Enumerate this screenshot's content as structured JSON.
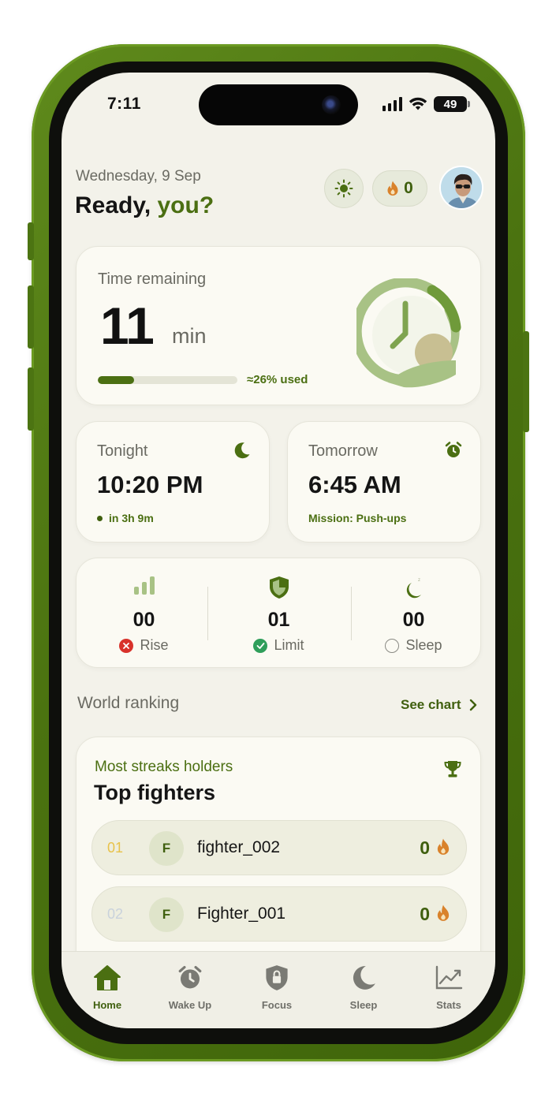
{
  "status_bar": {
    "time": "7:11",
    "battery": "49"
  },
  "header": {
    "date": "Wednesday, 9 Sep",
    "greeting_prefix": "Ready,",
    "greeting_name": "you?",
    "streak_count": "0"
  },
  "time_remaining": {
    "label": "Time remaining",
    "value": "11",
    "unit": "min",
    "used_fraction": 0.26,
    "used_text": "≈26% used"
  },
  "tonight": {
    "title": "Tonight",
    "time": "10:20 PM",
    "sub": "in 3h 9m"
  },
  "tomorrow": {
    "title": "Tomorrow",
    "time": "6:45 AM",
    "sub": "Mission: Push-ups"
  },
  "stats": [
    {
      "value": "00",
      "label": "Rise",
      "state": "failed"
    },
    {
      "value": "01",
      "label": "Limit",
      "state": "done"
    },
    {
      "value": "00",
      "label": "Sleep",
      "state": "pending"
    }
  ],
  "ranking": {
    "header": "World ranking",
    "see_chart": "See chart",
    "subtitle": "Most streaks holders",
    "title": "Top fighters",
    "rows": [
      {
        "rank": "01",
        "initial": "F",
        "name": "fighter_002",
        "score": "0",
        "rank_color": "#e8c24a"
      },
      {
        "rank": "02",
        "initial": "F",
        "name": "Fighter_001",
        "score": "0",
        "rank_color": "#c9d2dc"
      }
    ]
  },
  "tabs": [
    {
      "label": "Home",
      "icon": "home-icon",
      "active": true
    },
    {
      "label": "Wake Up",
      "icon": "alarm-clock-icon",
      "active": false
    },
    {
      "label": "Focus",
      "icon": "lock-shield-icon",
      "active": false
    },
    {
      "label": "Sleep",
      "icon": "moon-icon",
      "active": false
    },
    {
      "label": "Stats",
      "icon": "chart-icon",
      "active": false
    }
  ],
  "colors": {
    "accent": "#4b6f12",
    "case": "#4b7310",
    "background": "#f3f2ea",
    "fire": "#d9822b"
  }
}
